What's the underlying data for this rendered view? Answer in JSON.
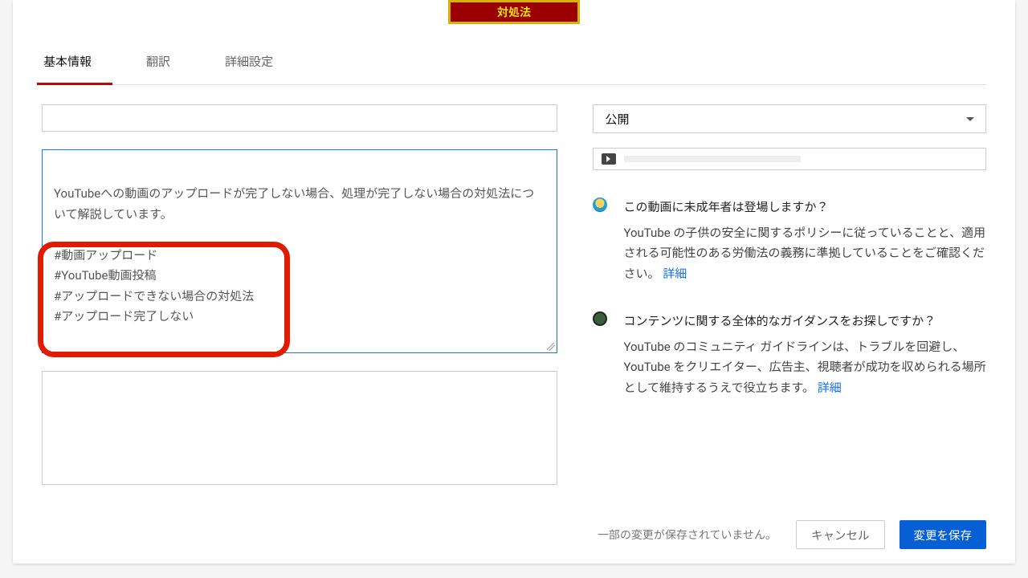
{
  "thumb_text": "対処法",
  "tabs": {
    "basic": "基本情報",
    "translate": "翻訳",
    "advanced": "詳細設定"
  },
  "title_value": "",
  "description": "YouTubeへの動画のアップロードが完了しない場合、処理が完了しない場合の対処法について解説しています。\n\n#動画アップロード\n#YouTube動画投稿\n#アップロードできない場合の対処法\n#アップロード完了しない",
  "privacy_selected": "公開",
  "minors": {
    "q": "この動画に未成年者は登場しますか？",
    "body": "YouTube の子供の安全に関するポリシーに従っていることと、適用される可能性のある労働法の義務に準拠していることをご確認ください。",
    "more": "詳細"
  },
  "guidance": {
    "q": "コンテンツに関する全体的なガイダンスをお探しですか？",
    "body": "YouTube のコミュニティ ガイドラインは、トラブルを回避し、YouTube をクリエイター、広告主、視聴者が成功を収められる場所として維持するうえで役立ちます。",
    "more": "詳細"
  },
  "footer": {
    "unsaved": "一部の変更が保存されていません。",
    "cancel": "キャンセル",
    "save": "変更を保存"
  }
}
